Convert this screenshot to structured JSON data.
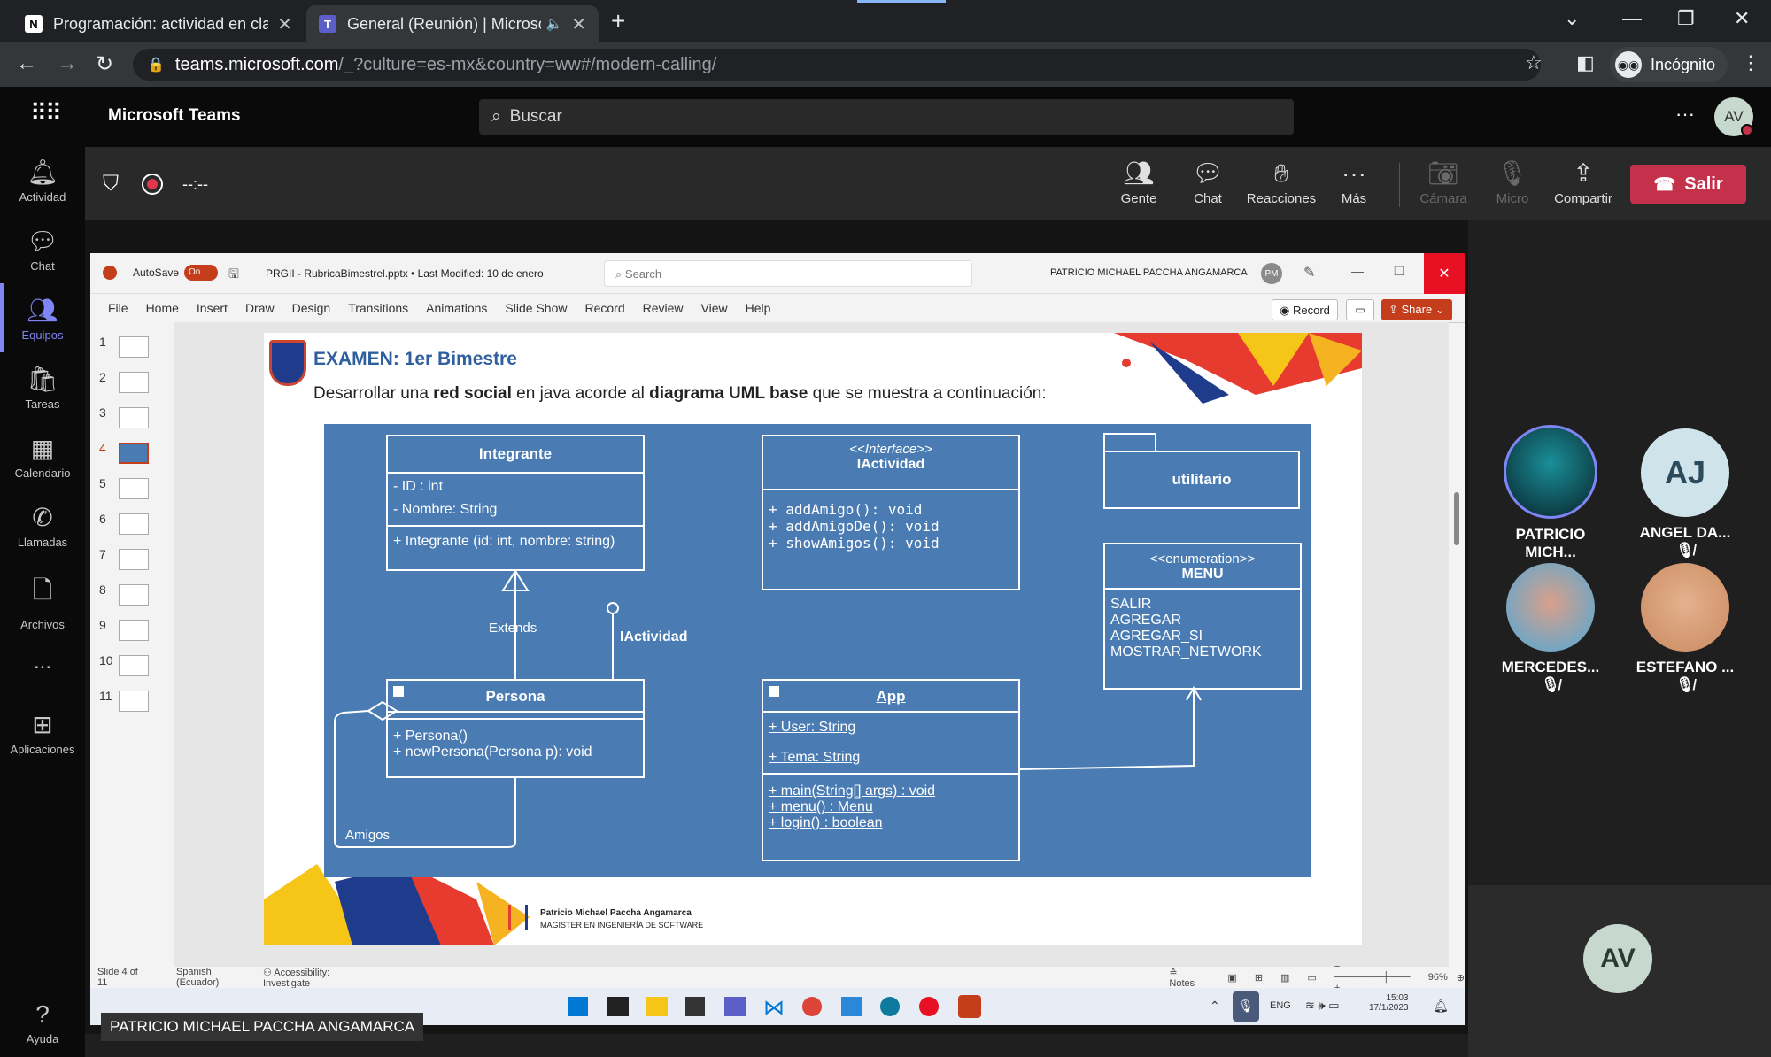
{
  "browser": {
    "tabs": [
      {
        "title": "Programación: actividad en clase",
        "icon": "notion-icon"
      },
      {
        "title": "General (Reunión) | Microsoft",
        "icon": "teams-icon",
        "active": true
      }
    ],
    "url_host": "teams.microsoft.com",
    "url_rest": "/_?culture=es-mx&country=ww#/modern-calling/",
    "incognito_label": "Incógnito"
  },
  "teams": {
    "app_name": "Microsoft Teams",
    "search_placeholder": "Buscar",
    "user_initials": "AV",
    "rail": [
      {
        "label": "Actividad",
        "icon": "bell-icon"
      },
      {
        "label": "Chat",
        "icon": "chat-icon"
      },
      {
        "label": "Equipos",
        "icon": "teams-icon",
        "active": true
      },
      {
        "label": "Tareas",
        "icon": "bag-icon"
      },
      {
        "label": "Calendario",
        "icon": "calendar-icon"
      },
      {
        "label": "Llamadas",
        "icon": "phone-icon"
      },
      {
        "label": "Archivos",
        "icon": "file-icon"
      },
      {
        "label": "...",
        "icon": "more-icon"
      },
      {
        "label": "Aplicaciones",
        "icon": "apps-icon"
      },
      {
        "label": "Ayuda",
        "icon": "help-icon"
      }
    ],
    "meeting": {
      "timer": "--:--",
      "buttons": [
        {
          "label": "Gente",
          "icon": "people-icon"
        },
        {
          "label": "Chat",
          "icon": "chat-icon"
        },
        {
          "label": "Reacciones",
          "icon": "reactions-icon"
        },
        {
          "label": "Más",
          "icon": "more-icon"
        },
        {
          "label": "Cámara",
          "icon": "camera-off-icon",
          "disabled": true
        },
        {
          "label": "Micro",
          "icon": "mic-off-icon",
          "disabled": true
        },
        {
          "label": "Compartir",
          "icon": "share-icon"
        }
      ],
      "leave_label": "Salir"
    },
    "participants": [
      {
        "name": "PATRICIO MICH...",
        "initials": "",
        "muted": false
      },
      {
        "name": "ANGEL DA...",
        "initials": "AJ",
        "muted": true
      },
      {
        "name": "MERCEDES...",
        "initials": "",
        "muted": true
      },
      {
        "name": "ESTEFANO ...",
        "initials": "",
        "muted": true
      }
    ],
    "self_initials": "AV",
    "presenter_tag": "PATRICIO MICHAEL PACCHA ANGAMARCA"
  },
  "ppt": {
    "autosave": "AutoSave",
    "toggle": "On",
    "filename": "PRGII - RubricaBimestrel.pptx • Last Modified: 10 de enero",
    "search": "Search",
    "owner": "PATRICIO MICHAEL PACCHA ANGAMARCA",
    "owner_initials": "PM",
    "menu": [
      "File",
      "Home",
      "Insert",
      "Draw",
      "Design",
      "Transitions",
      "Animations",
      "Slide Show",
      "Record",
      "Review",
      "View",
      "Help"
    ],
    "record_btn": "Record",
    "share_btn": "Share",
    "slide_numbers": [
      "1",
      "2",
      "3",
      "4",
      "5",
      "6",
      "7",
      "8",
      "9",
      "10",
      "11"
    ],
    "status": {
      "slide": "Slide 4 of 11",
      "lang": "Spanish (Ecuador)",
      "access": "Accessibility: Investigate",
      "notes": "Notes",
      "zoom": "96%"
    },
    "taskbar": {
      "lang": "ENG",
      "time": "15:03",
      "date": "17/1/2023"
    }
  },
  "slide": {
    "title": "EXAMEN: 1er Bimestre",
    "sub_a": "Desarrollar una ",
    "sub_b": "red social",
    "sub_c": " en java acorde al ",
    "sub_d": "diagrama UML base",
    "sub_e": " que se muestra a continuación:",
    "footer_name": "Patricio Michael Paccha Angamarca",
    "footer_title": "MAGISTER EN INGENIERÍA DE SOFTWARE",
    "uml": {
      "integrante": {
        "name": "Integrante",
        "attrs": [
          "- ID : int",
          "- Nombre: String"
        ],
        "ops": [
          "+ Integrante (id: int, nombre: string)"
        ]
      },
      "iactividad": {
        "stereo": "<<Interface>>",
        "name": "IActividad",
        "ops": [
          "+ addAmigo(): void",
          "+ addAmigoDe(): void",
          "+ showAmigos(): void"
        ]
      },
      "utilitario": {
        "name": "utilitario"
      },
      "menu": {
        "stereo": "<<enumeration>>",
        "name": "MENU",
        "values": [
          "SALIR",
          "AGREGAR",
          "AGREGAR_SI",
          "MOSTRAR_NETWORK"
        ]
      },
      "persona": {
        "name": "Persona",
        "ops": [
          "+ Persona()",
          "+ newPersona(Persona p): void"
        ]
      },
      "app": {
        "name": "App",
        "attrs": [
          "+ User: String",
          "+ Tema: String"
        ],
        "ops": [
          "+ main(String[] args) : void",
          "+ menu() : Menu",
          "+ login() : boolean"
        ]
      },
      "label_extends": "Extends",
      "label_iactividad": "IActividad",
      "label_amigos": "Amigos"
    }
  }
}
